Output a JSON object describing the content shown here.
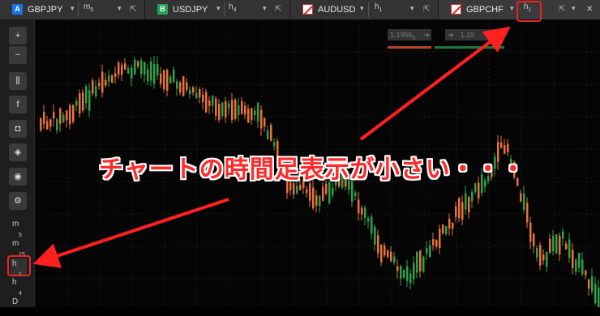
{
  "tabs": [
    {
      "badge": "A",
      "badge_color": "#1a73e8",
      "symbol": "GBPJPY",
      "tf": "m",
      "tf_sub": "5"
    },
    {
      "badge": "B",
      "badge_color": "#23a455",
      "symbol": "USDJPY",
      "tf": "h",
      "tf_sub": "4"
    },
    {
      "badge": "",
      "badge_color": "",
      "symbol": "AUDUSD",
      "tf": "h",
      "tf_sub": "1"
    },
    {
      "badge": "",
      "badge_color": "",
      "symbol": "GBPCHF",
      "tf": "h",
      "tf_sub": "1"
    }
  ],
  "icons": {
    "dropdown": "▾",
    "popout": "⇱",
    "close": "✕"
  },
  "toolbar": {
    "buttons": [
      {
        "name": "zoom-in-icon",
        "glyph": "+"
      },
      {
        "name": "zoom-out-icon",
        "glyph": "−"
      },
      {
        "name": "candles-icon",
        "glyph": "⫼"
      },
      {
        "name": "facebook-icon",
        "glyph": "f"
      },
      {
        "name": "robot-icon",
        "glyph": "◘"
      },
      {
        "name": "layers-icon",
        "glyph": "◈"
      },
      {
        "name": "eye-icon",
        "glyph": "◉"
      },
      {
        "name": "settings-icon",
        "glyph": "⚙"
      }
    ],
    "timeframes": [
      {
        "tf": "m",
        "sub": "5"
      },
      {
        "tf": "m",
        "sub": "15"
      },
      {
        "tf": "h",
        "sub": "1"
      },
      {
        "tf": "h",
        "sub": "4"
      },
      {
        "tf": "D",
        "sub": ""
      }
    ]
  },
  "price": {
    "sell": "1.1956",
    "sell_suffix": "5",
    "buy": "1.19"
  },
  "colors": {
    "bull": "#2ea14a",
    "bear": "#e8743b",
    "accent": "#ff2a2a"
  },
  "annotation": "チャートの時間足表示が小さい・・・"
}
